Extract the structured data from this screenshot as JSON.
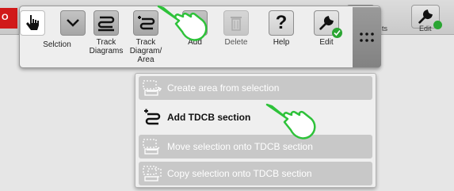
{
  "background_toolbar": {
    "red_tab_text": "O",
    "partial_label": "ts",
    "edit_label": "Edit"
  },
  "toolbar": {
    "tools": [
      {
        "id": "selection",
        "label": "Selction",
        "icon": "pointer-hand-icon"
      },
      {
        "id": "chevron",
        "label": "",
        "icon": "chevron-down-icon"
      },
      {
        "id": "track-diagrams",
        "label": "Track\nDiagrams",
        "icon": "track-diagram-icon"
      },
      {
        "id": "track-diagram-area",
        "label": "Track\nDiagram/\nArea",
        "icon": "track-diagram-add-icon"
      },
      {
        "id": "add",
        "label": "Add",
        "icon": "add-icon"
      },
      {
        "id": "delete",
        "label": "Delete",
        "icon": "trash-icon"
      },
      {
        "id": "help",
        "label": "Help",
        "icon": "help-icon"
      },
      {
        "id": "edit",
        "label": "Edit",
        "icon": "wrench-icon"
      }
    ],
    "help_glyph": "?",
    "grip_icon": "grid-dots-icon"
  },
  "menu": {
    "items": [
      {
        "label": "Create area from selection",
        "enabled": false,
        "icon": "create-area-icon"
      },
      {
        "label": "Add TDCB section",
        "enabled": true,
        "icon": "add-tdcb-icon"
      },
      {
        "label": "Move selection onto TDCB section",
        "enabled": false,
        "icon": "move-selection-icon"
      },
      {
        "label": "Copy selection onto TDCB section",
        "enabled": false,
        "icon": "copy-selection-icon"
      }
    ]
  },
  "colors": {
    "accent_green": "#2aa532",
    "red_tab": "#d11a1a"
  }
}
